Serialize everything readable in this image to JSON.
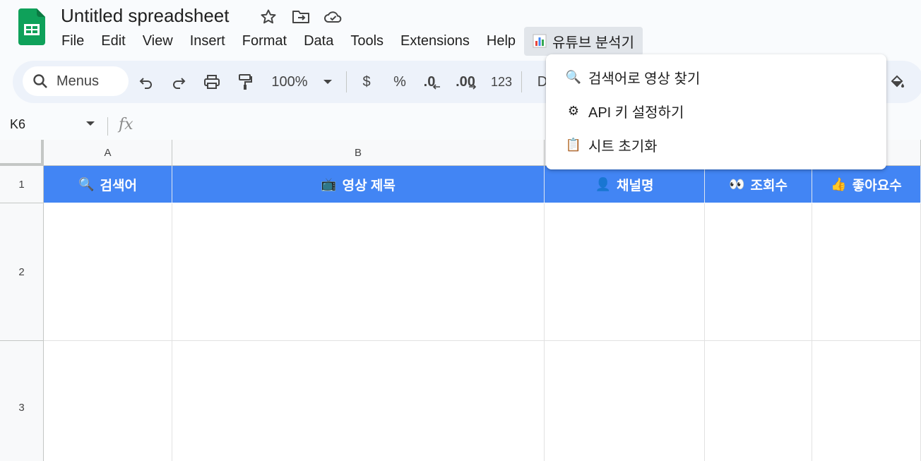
{
  "doc": {
    "title": "Untitled spreadsheet"
  },
  "menus": [
    "File",
    "Edit",
    "View",
    "Insert",
    "Format",
    "Data",
    "Tools",
    "Extensions",
    "Help"
  ],
  "custom_menu": {
    "icon": "bar-chart-icon",
    "label": "유튜브 분석기"
  },
  "toolbar": {
    "search_label": "Menus",
    "zoom": "100%",
    "currency": "$",
    "percent": "%",
    "decrease_decimal": ".0",
    "increase_decimal": ".00",
    "number_format": "123",
    "font_partial": "D"
  },
  "formula_bar": {
    "cell_ref": "K6",
    "fx": "fx"
  },
  "columns": [
    "A",
    "B",
    "",
    "",
    ""
  ],
  "rows": [
    "1",
    "2",
    "3"
  ],
  "header_row": [
    {
      "emoji": "🔍",
      "label": "검색어"
    },
    {
      "emoji": "📺",
      "label": "영상 제목"
    },
    {
      "emoji": "👤",
      "label": "채널명"
    },
    {
      "emoji": "👀",
      "label": "조회수"
    },
    {
      "emoji": "👍",
      "label": "좋아요수"
    }
  ],
  "dropdown": [
    {
      "emoji": "🔍",
      "label": "검색어로 영상 찾기"
    },
    {
      "emoji": "⚙",
      "label": "API 키 설정하기"
    },
    {
      "emoji": "📋",
      "label": "시트 초기화"
    }
  ],
  "colors": {
    "header_fill": "#4285f4",
    "sheets_green": "#0f9d58",
    "toolbar_bg": "#edf2fa"
  }
}
